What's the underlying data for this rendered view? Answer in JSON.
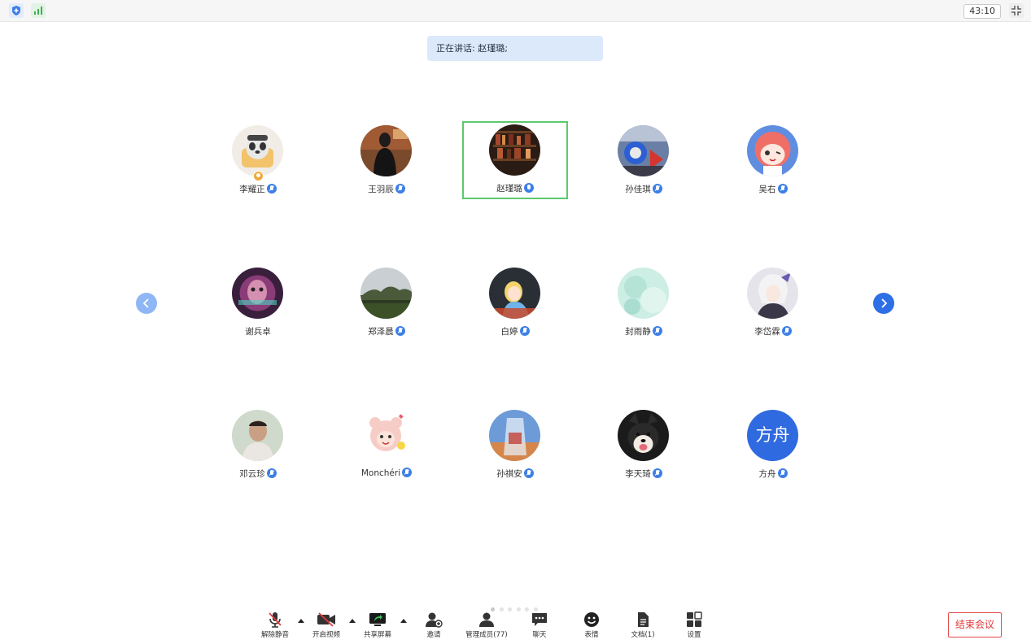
{
  "topbar": {
    "timer": "43:10"
  },
  "speaking_banner": {
    "text": "正在讲话: 赵瑾璐;"
  },
  "participants": [
    {
      "name": "李耀正",
      "mic": "muted",
      "host": true,
      "avatar": "panda-icon"
    },
    {
      "name": "王羽辰",
      "mic": "muted",
      "avatar": "person-dark-icon"
    },
    {
      "name": "赵瑾璐",
      "mic": "active",
      "speaking": true,
      "avatar": "bookshelf-icon"
    },
    {
      "name": "孙佳琪",
      "mic": "muted",
      "avatar": "graffiti-icon"
    },
    {
      "name": "吴右",
      "mic": "muted",
      "avatar": "anime-girl-icon"
    },
    {
      "name": "谢兵卓",
      "mic": "none",
      "avatar": "neon-face-icon"
    },
    {
      "name": "郑泽晨",
      "mic": "muted",
      "avatar": "landscape-icon"
    },
    {
      "name": "白婷",
      "mic": "muted",
      "avatar": "alice-icon"
    },
    {
      "name": "封雨静",
      "mic": "muted",
      "avatar": "watercolor-icon"
    },
    {
      "name": "李岱霖",
      "mic": "muted",
      "avatar": "anime-character-icon"
    },
    {
      "name": "邓云珍",
      "mic": "muted",
      "avatar": "man-portrait-icon"
    },
    {
      "name": "Monchéri",
      "mic": "muted",
      "avatar": "bear-cartoon-icon"
    },
    {
      "name": "孙祺安",
      "mic": "muted",
      "avatar": "sky-bottle-icon"
    },
    {
      "name": "李天琦",
      "mic": "muted",
      "avatar": "shiba-dog-icon"
    },
    {
      "name": "方舟",
      "mic": "muted",
      "avatar_text": "方舟",
      "avatar": "text-avatar"
    }
  ],
  "toolbar": {
    "unmute": "解除静音",
    "video": "开启视频",
    "share": "共享屏幕",
    "invite": "邀请",
    "members": "管理成员(77)",
    "chat": "聊天",
    "emoji": "表情",
    "docs": "文档(1)",
    "settings": "设置"
  },
  "end_meeting": "结束会议",
  "colors": {
    "accent": "#2e6fe6",
    "speaker_border": "#5cc96b",
    "end": "#e03a3a",
    "host": "#f0a83a"
  }
}
